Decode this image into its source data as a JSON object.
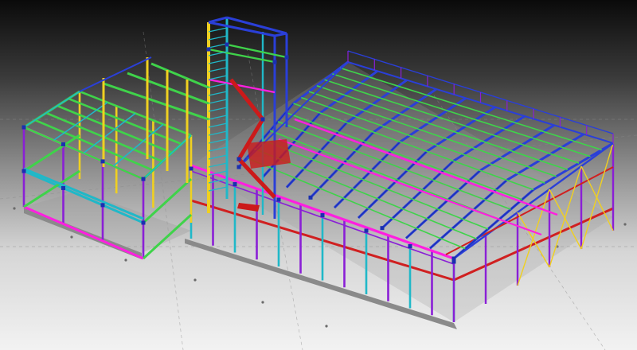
{
  "viewer": {
    "background_top": "#0a0a0a",
    "background_bottom": "#f2f2f2"
  },
  "model": {
    "kind": "3D steel structure",
    "member_colors": {
      "column": "#8a1fd6",
      "primary_beam": "#ff1fe0",
      "secondary_beam": "#2a3fd8",
      "purlin": "#3fd34a",
      "edge_beam": "#20b8c8",
      "bracing": "#f0d020",
      "base_beam": "#d02020",
      "stair": "#cc1a1a",
      "connection": "#1a2fb0",
      "slab": "#9a9a9a"
    }
  }
}
